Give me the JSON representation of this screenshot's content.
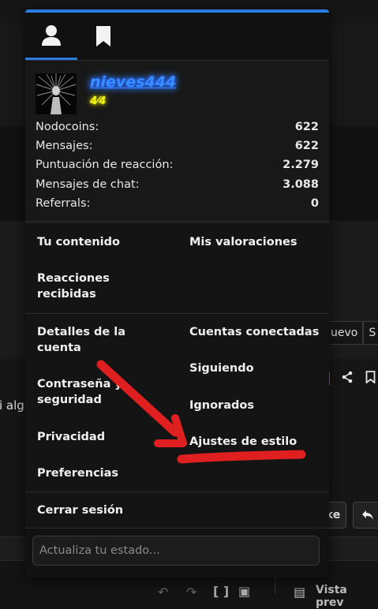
{
  "background": {
    "tabs": [
      "uevo",
      "S"
    ],
    "partial_text": "i alg",
    "reply_button_text": "ke",
    "footer": {
      "preview_label": "Vista prev"
    }
  },
  "menu": {
    "tabs": [
      {
        "icon": "user-icon"
      },
      {
        "icon": "bookmark-icon"
      }
    ],
    "profile": {
      "username": "nieves444",
      "user_title": "4⁄4"
    },
    "stats": [
      {
        "label": "Nodocoins:",
        "value": "622"
      },
      {
        "label": "Mensajes:",
        "value": "622"
      },
      {
        "label": "Puntuación de reacción:",
        "value": "2.279"
      },
      {
        "label": "Mensajes de chat:",
        "value": "3.088"
      },
      {
        "label": "Referrals:",
        "value": "0"
      }
    ],
    "links_left_1": [
      "Tu contenido",
      "Reacciones recibidas"
    ],
    "links_right_1": [
      "Mis valoraciones"
    ],
    "links_left_2": [
      "Detalles de la cuenta",
      "Contraseña y seguridad",
      "Privacidad",
      "Preferencias"
    ],
    "links_right_2": [
      "Cuentas conectadas",
      "Siguiendo",
      "Ignorados",
      "Ajustes de estilo"
    ],
    "logout": "Cerrar sesión",
    "status_placeholder": "Actualiza tu estado..."
  },
  "colors": {
    "accent": "#2b7de3",
    "username": "#3a8dff",
    "user_title": "#f3f316",
    "annotation": "#e02020"
  }
}
